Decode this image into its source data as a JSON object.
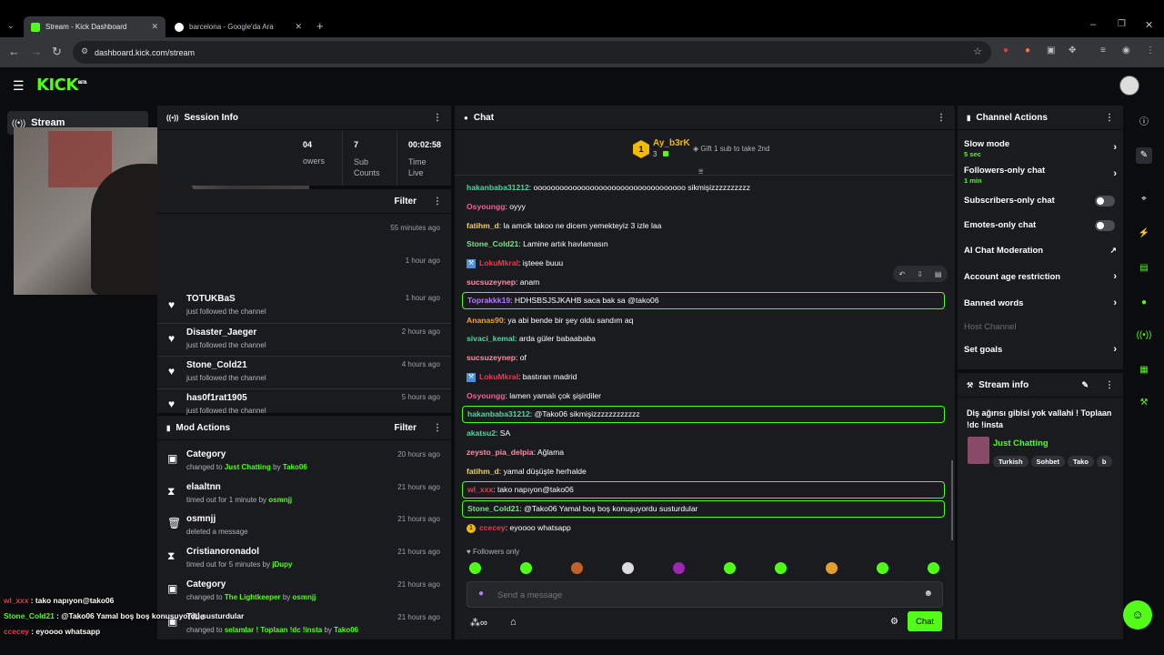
{
  "browser": {
    "tabs": [
      {
        "title": "Stream - Kick Dashboard"
      },
      {
        "title": "barcelona - Google'da Ara"
      }
    ],
    "url": "dashboard.kick.com/stream"
  },
  "sidebar": {
    "stream_label": "Stream"
  },
  "session_info": {
    "title": "Session Info",
    "stats": [
      {
        "value": "04",
        "label": "owers"
      },
      {
        "value": "7",
        "label": "Sub Counts"
      },
      {
        "value": "00:02:58",
        "label": "Time Live"
      }
    ]
  },
  "activity": {
    "filter_label": "Filter",
    "items": [
      {
        "time": "55 minutes ago",
        "user": "",
        "action": ""
      },
      {
        "time": "1 hour ago",
        "user": "",
        "action": ""
      },
      {
        "time": "1 hour ago",
        "user": "TOTUKBaS",
        "action": "just followed the channel"
      },
      {
        "time": "2 hours ago",
        "user": "Disaster_Jaeger",
        "action": "just followed the channel"
      },
      {
        "time": "4 hours ago",
        "user": "Stone_Cold21",
        "action": "just followed the channel"
      },
      {
        "time": "5 hours ago",
        "user": "has0f1rat1905",
        "action": "just followed the channel"
      }
    ]
  },
  "mod_actions": {
    "title": "Mod Actions",
    "filter_label": "Filter",
    "items": [
      {
        "title": "Category",
        "pre": "changed to ",
        "target": "Just Chatting",
        "by": " by ",
        "mod": "Tako06",
        "time": "20 hours ago",
        "icon": "category-icon"
      },
      {
        "title": "elaaltnn",
        "pre": "timed out for 1 minute",
        "target": "",
        "by": " by ",
        "mod": "osmnjj",
        "time": "21 hours ago",
        "icon": "hourglass-icon"
      },
      {
        "title": "osmnjj",
        "pre": "deleted a message",
        "target": "",
        "by": "",
        "mod": "",
        "time": "21 hours ago",
        "icon": "trash-icon"
      },
      {
        "title": "Cristianoronadol",
        "pre": "timed out for 5 minutes",
        "target": "",
        "by": " by ",
        "mod": "jDupy",
        "time": "21 hours ago",
        "icon": "hourglass-icon"
      },
      {
        "title": "Category",
        "pre": "changed to ",
        "target": "The Lightkeeper",
        "by": " by ",
        "mod": "osmnjj",
        "time": "21 hours ago",
        "icon": "category-icon"
      },
      {
        "title": "Title",
        "pre": "changed to ",
        "target": "selamlar ! Toplaan !dc !insta",
        "by": " by ",
        "mod": "Tako06",
        "time": "21 hours ago",
        "icon": "category-icon"
      }
    ]
  },
  "overlay_chat": [
    {
      "user": "wl_xxx",
      "text": " : tako napıyon@tako06"
    },
    {
      "user": "Stone_Cold21",
      "text": " : @Tako06 Yamal boş boş konuşuyordu susturdular"
    },
    {
      "user": "ccecey",
      "text": " : eyoooo whatsapp"
    }
  ],
  "chat": {
    "title": "Chat",
    "gifter": {
      "rank": "1",
      "name": "Ay_b3rK",
      "count": "3",
      "gift_text": "Gift 1 sub to take 2nd"
    },
    "messages": [
      {
        "user": "hakanbaba31212",
        "text": ": ooooooooooooooooooooooooooooooooooo sikmişizzzzzzzzzz",
        "color": "#53d4a0",
        "hl": false
      },
      {
        "user": "Osyoungg",
        "text": ": oyyy",
        "color": "#f06292",
        "hl": false
      },
      {
        "user": "fatihm_d",
        "text": ": la amcik takoo ne dicem yemekteyiz 3 izle laa",
        "color": "#f0d060",
        "hl": false
      },
      {
        "user": "Stone_Cold21",
        "text": ": Lamine artık havlamasın",
        "color": "#7ee08a",
        "hl": false
      },
      {
        "user": "LokuMkral",
        "text": ": işteee buuu",
        "color": "#e04050",
        "hl": false,
        "badge": true
      },
      {
        "user": "sucsuzeynep",
        "text": ": anam",
        "color": "#ff8fa3",
        "hl": false
      },
      {
        "user": "Toprakkk19",
        "text": ": HDHSBSJSJKAHB saca bak sa @tako06",
        "color": "#b57cff",
        "hl": true
      },
      {
        "user": "Ananas90",
        "text": ": ya abi bende bir şey oldu sandım aq",
        "color": "#f0a040",
        "hl": false
      },
      {
        "user": "sivaci_kemal",
        "text": ": arda güler babaababa",
        "color": "#53d4a0",
        "hl": false
      },
      {
        "user": "sucsuzeynep",
        "text": ": of",
        "color": "#ff8fa3",
        "hl": false
      },
      {
        "user": "LokuMkral",
        "text": ": bastıran madrid",
        "color": "#e04050",
        "hl": false,
        "badge": true
      },
      {
        "user": "Osyoungg",
        "text": ": lamen yamalı çok şişirdiler",
        "color": "#f06292",
        "hl": false
      },
      {
        "user": "hakanbaba31212",
        "text": ": @Tako06 sikmişizzzzzzzzzzzz",
        "color": "#53d4a0",
        "hl": true
      },
      {
        "user": "akatsu2",
        "text": ": SA",
        "color": "#53d4a0",
        "hl": false
      },
      {
        "user": "zeysto_pia_delpia",
        "text": ": Ağlama",
        "color": "#ff8fa3",
        "hl": false
      },
      {
        "user": "fatihm_d",
        "text": ": yamal düşüşte herhalde",
        "color": "#f0d060",
        "hl": false
      },
      {
        "user": "wl_xxx",
        "text": ": tako napıyon@tako06",
        "color": "#e04050",
        "hl": true
      },
      {
        "user": "Stone_Cold21",
        "text": ": @Tako06 Yamal boş boş konuşuyordu susturdular",
        "color": "#7ee08a",
        "hl": true
      },
      {
        "user": "ccecey",
        "text": ": eyoooo whatsapp",
        "color": "#e04050",
        "hl": false,
        "rank": "1"
      }
    ],
    "followers_only": "Followers only",
    "input_placeholder": "Send a message",
    "send_label": "Chat"
  },
  "channel_actions": {
    "title": "Channel Actions",
    "items": [
      {
        "label": "Slow mode",
        "sub": "5 sec",
        "kind": "chevron"
      },
      {
        "label": "Followers-only chat",
        "sub": "1 min",
        "kind": "chevron"
      },
      {
        "label": "Subscribers-only chat",
        "sub": "",
        "kind": "toggle"
      },
      {
        "label": "Emotes-only chat",
        "sub": "",
        "kind": "toggle"
      },
      {
        "label": "AI Chat Moderation",
        "sub": "",
        "kind": "external"
      },
      {
        "label": "Account age restriction",
        "sub": "",
        "kind": "chevron"
      },
      {
        "label": "Banned words",
        "sub": "",
        "kind": "chevron"
      },
      {
        "label": "Host Channel",
        "sub": "",
        "kind": "disabled"
      },
      {
        "label": "Set goals",
        "sub": "",
        "kind": "chevron"
      }
    ]
  },
  "stream_info": {
    "title": "Stream info",
    "stream_title": "Diş ağırısı gibisi yok vallahi ! Toplaan !dc !insta",
    "category": "Just Chatting",
    "tags": [
      "Turkish",
      "Sohbet",
      "Tako",
      "b"
    ]
  },
  "colors": {
    "accent": "#53fc18",
    "panel": "#191b1f",
    "bg": "#0b0c0d"
  }
}
